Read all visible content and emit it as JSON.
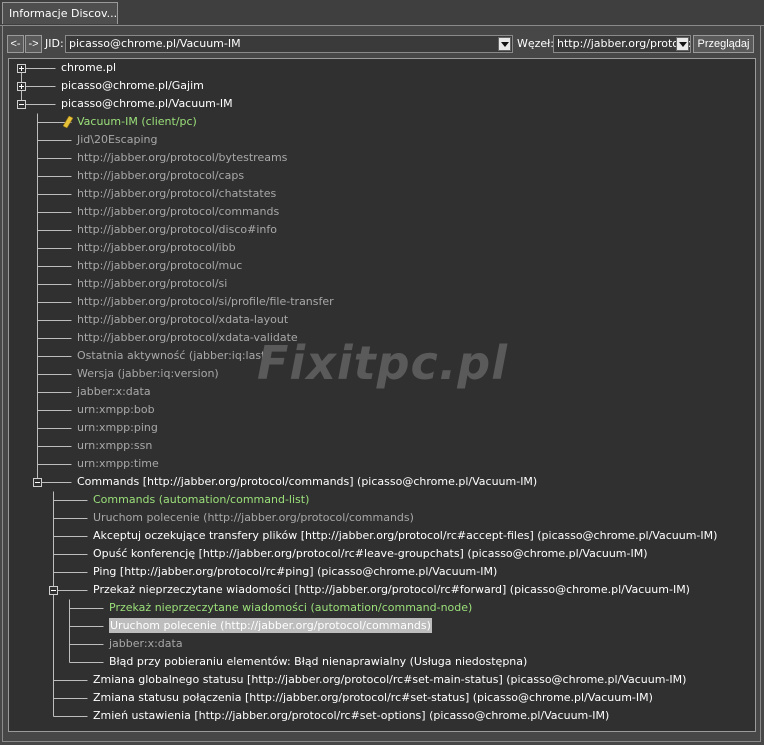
{
  "tab": {
    "label": "Informacje Discov..."
  },
  "toolbar": {
    "back_label": "<-",
    "forward_label": "->",
    "jid_label": "JID:",
    "jid_value": "picasso@chrome.pl/Vacuum-IM",
    "node_label": "Węzeł:",
    "node_value": "http://jabber.org/protocol/commands",
    "browse_label": "Przeglądaj"
  },
  "watermark": "Fixitpc.pl",
  "colors": {
    "background": "#474747",
    "tree_bg": "#303030",
    "identity_green": "#9be07a",
    "feature_gray": "#a8a8a8",
    "selection": "#bdbdbd"
  },
  "tree": [
    {
      "text": "chrome.pl",
      "level": 0,
      "style": "normal",
      "expander": "plus"
    },
    {
      "text": "picasso@chrome.pl/Gajim",
      "level": 0,
      "style": "normal",
      "expander": "plus"
    },
    {
      "text": "picasso@chrome.pl/Vacuum-IM",
      "level": 0,
      "style": "normal",
      "expander": "minus"
    },
    {
      "text": "Vacuum-IM (client/pc)",
      "level": 1,
      "style": "green",
      "icon": "client-icon"
    },
    {
      "text": "Jid\\20Escaping",
      "level": 1,
      "style": "gray"
    },
    {
      "text": "http://jabber.org/protocol/bytestreams",
      "level": 1,
      "style": "gray"
    },
    {
      "text": "http://jabber.org/protocol/caps",
      "level": 1,
      "style": "gray"
    },
    {
      "text": "http://jabber.org/protocol/chatstates",
      "level": 1,
      "style": "gray"
    },
    {
      "text": "http://jabber.org/protocol/commands",
      "level": 1,
      "style": "gray"
    },
    {
      "text": "http://jabber.org/protocol/disco#info",
      "level": 1,
      "style": "gray"
    },
    {
      "text": "http://jabber.org/protocol/ibb",
      "level": 1,
      "style": "gray"
    },
    {
      "text": "http://jabber.org/protocol/muc",
      "level": 1,
      "style": "gray"
    },
    {
      "text": "http://jabber.org/protocol/si",
      "level": 1,
      "style": "gray"
    },
    {
      "text": "http://jabber.org/protocol/si/profile/file-transfer",
      "level": 1,
      "style": "gray"
    },
    {
      "text": "http://jabber.org/protocol/xdata-layout",
      "level": 1,
      "style": "gray"
    },
    {
      "text": "http://jabber.org/protocol/xdata-validate",
      "level": 1,
      "style": "gray"
    },
    {
      "text": "Ostatnia aktywność (jabber:iq:last)",
      "level": 1,
      "style": "gray"
    },
    {
      "text": "Wersja (jabber:iq:version)",
      "level": 1,
      "style": "gray"
    },
    {
      "text": "jabber:x:data",
      "level": 1,
      "style": "gray"
    },
    {
      "text": "urn:xmpp:bob",
      "level": 1,
      "style": "gray"
    },
    {
      "text": "urn:xmpp:ping",
      "level": 1,
      "style": "gray"
    },
    {
      "text": "urn:xmpp:ssn",
      "level": 1,
      "style": "gray"
    },
    {
      "text": "urn:xmpp:time",
      "level": 1,
      "style": "gray"
    },
    {
      "text": "Commands [http://jabber.org/protocol/commands] (picasso@chrome.pl/Vacuum-IM)",
      "level": 1,
      "style": "normal",
      "expander": "minus"
    },
    {
      "text": "Commands (automation/command-list)",
      "level": 2,
      "style": "green"
    },
    {
      "text": "Uruchom polecenie (http://jabber.org/protocol/commands)",
      "level": 2,
      "style": "gray"
    },
    {
      "text": "Akceptuj oczekujące transfery plików [http://jabber.org/protocol/rc#accept-files] (picasso@chrome.pl/Vacuum-IM)",
      "level": 2,
      "style": "normal"
    },
    {
      "text": "Opuść konferencję [http://jabber.org/protocol/rc#leave-groupchats] (picasso@chrome.pl/Vacuum-IM)",
      "level": 2,
      "style": "normal"
    },
    {
      "text": "Ping [http://jabber.org/protocol/rc#ping] (picasso@chrome.pl/Vacuum-IM)",
      "level": 2,
      "style": "normal"
    },
    {
      "text": "Przekaż nieprzeczytane wiadomości [http://jabber.org/protocol/rc#forward] (picasso@chrome.pl/Vacuum-IM)",
      "level": 2,
      "style": "normal",
      "expander": "minus"
    },
    {
      "text": "Przekaż nieprzeczytane wiadomości (automation/command-node)",
      "level": 3,
      "style": "green"
    },
    {
      "text": "Uruchom polecenie (http://jabber.org/protocol/commands)",
      "level": 3,
      "style": "selected"
    },
    {
      "text": "jabber:x:data",
      "level": 3,
      "style": "gray"
    },
    {
      "text": "Błąd przy pobieraniu elementów: Błąd nienaprawialny (Usługa niedostępna)",
      "level": 3,
      "style": "normal"
    },
    {
      "text": "Zmiana globalnego statusu [http://jabber.org/protocol/rc#set-main-status] (picasso@chrome.pl/Vacuum-IM)",
      "level": 2,
      "style": "normal"
    },
    {
      "text": "Zmiana statusu połączenia [http://jabber.org/protocol/rc#set-status] (picasso@chrome.pl/Vacuum-IM)",
      "level": 2,
      "style": "normal"
    },
    {
      "text": "Zmień  ustawienia [http://jabber.org/protocol/rc#set-options] (picasso@chrome.pl/Vacuum-IM)",
      "level": 2,
      "style": "normal"
    }
  ]
}
